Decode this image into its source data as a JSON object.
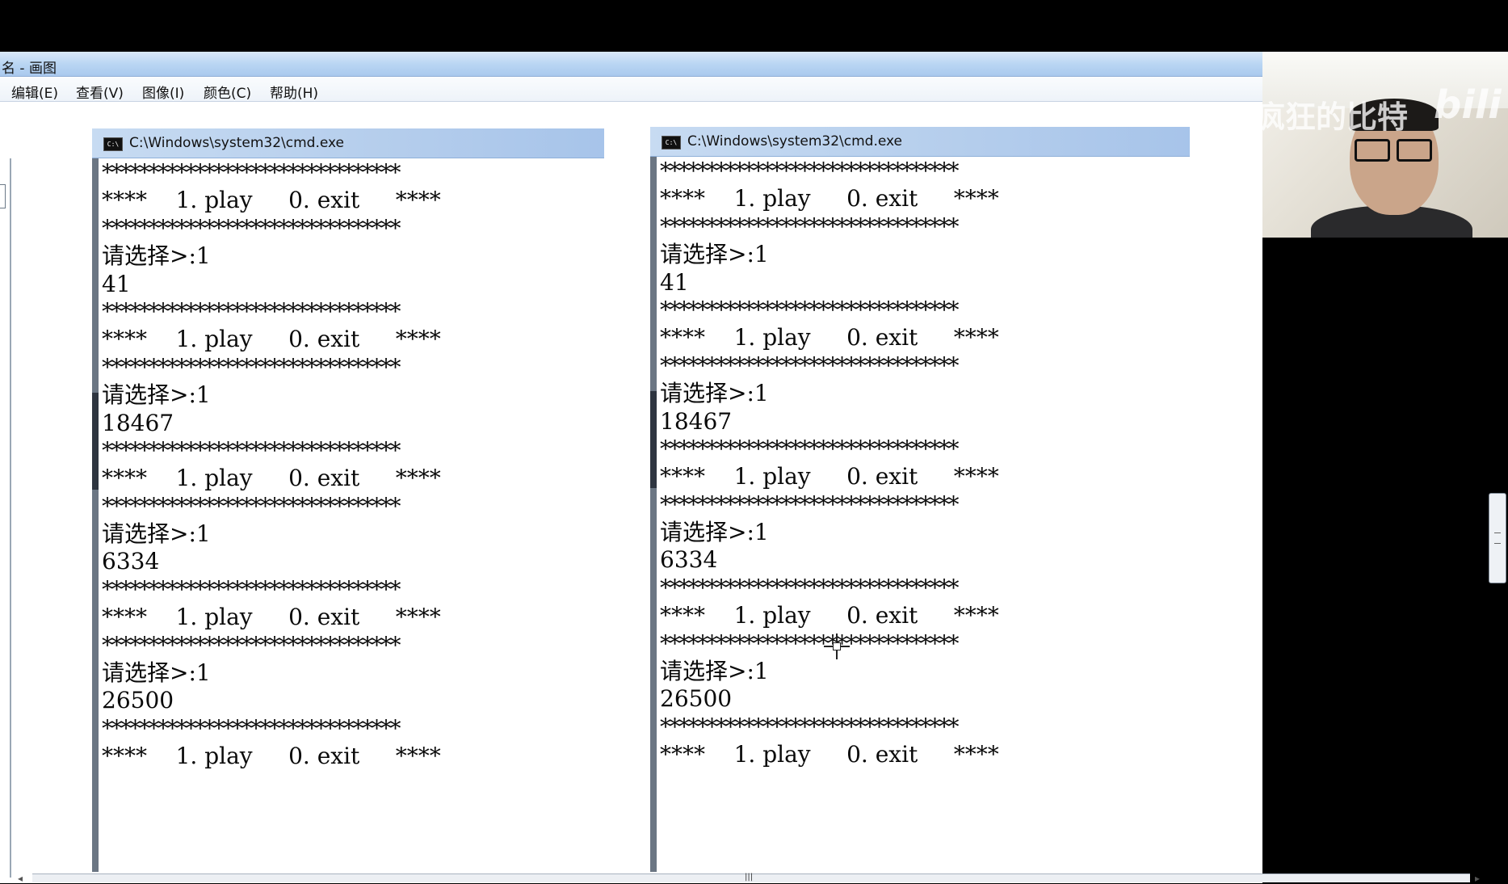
{
  "paint": {
    "title": "名 - 画图",
    "menu": [
      "编辑(E)",
      "查看(V)",
      "图像(I)",
      "颜色(C)",
      "帮助(H)"
    ]
  },
  "icons": {
    "cmd": "cmd-window-icon",
    "crosshair": "crosshair-cursor-icon"
  },
  "cmd_windows": [
    {
      "title": "C:\\Windows\\system32\\cmd.exe",
      "lines": [
        "********************************",
        "****    1. play     0. exit     ****",
        "********************************",
        "请选择>:1",
        "41",
        "********************************",
        "****    1. play     0. exit     ****",
        "********************************",
        "请选择>:1",
        "18467",
        "********************************",
        "****    1. play     0. exit     ****",
        "********************************",
        "请选择>:1",
        "6334",
        "********************************",
        "****    1. play     0. exit     ****",
        "********************************",
        "请选择>:1",
        "26500",
        "********************************",
        "****    1. play     0. exit     ****"
      ]
    },
    {
      "title": "C:\\Windows\\system32\\cmd.exe",
      "lines": [
        "********************************",
        "****    1. play     0. exit     ****",
        "********************************",
        "请选择>:1",
        "41",
        "********************************",
        "****    1. play     0. exit     ****",
        "********************************",
        "请选择>:1",
        "18467",
        "********************************",
        "****    1. play     0. exit     ****",
        "********************************",
        "请选择>:1",
        "6334",
        "********************************",
        "****    1. play     0. exit     ****",
        "********************************",
        "请选择>:1",
        "26500",
        "********************************",
        "****    1. play     0. exit     ****"
      ]
    }
  ],
  "webcam": {
    "watermark": "疯狂的比特",
    "logo": "bili"
  }
}
